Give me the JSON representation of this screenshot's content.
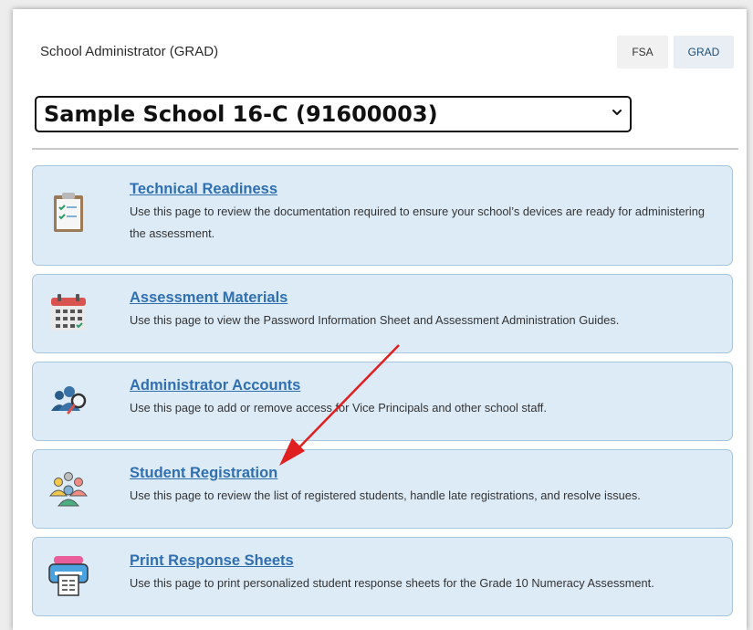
{
  "header": {
    "title": "School Administrator (GRAD)",
    "tabs": [
      {
        "label": "FSA"
      },
      {
        "label": "GRAD"
      }
    ]
  },
  "school_select": {
    "value": "Sample School 16-C (91600003)"
  },
  "cards": [
    {
      "title": "Technical Readiness",
      "description": "Use this page to review the documentation required to ensure your school’s devices are ready for administering the assessment.",
      "icon": "clipboard-icon"
    },
    {
      "title": "Assessment Materials",
      "description": "Use this page to view the Password Information Sheet and Assessment Administration Guides.",
      "icon": "calendar-icon"
    },
    {
      "title": "Administrator Accounts",
      "description": "Use this page to add or remove access for Vice Principals and other school staff.",
      "icon": "users-search-icon"
    },
    {
      "title": "Student Registration",
      "description": "Use this page to review the list of registered students, handle late registrations, and resolve issues.",
      "icon": "students-icon"
    },
    {
      "title": "Print Response Sheets",
      "description": "Use this page to print personalized student response sheets for the Grade 10 Numeracy Assessment.",
      "icon": "printer-icon"
    }
  ],
  "colors": {
    "link": "#2f6fb2",
    "card_bg": "#ddebf7",
    "card_border": "#a9c4dc",
    "annotation_arrow": "#e02020"
  }
}
